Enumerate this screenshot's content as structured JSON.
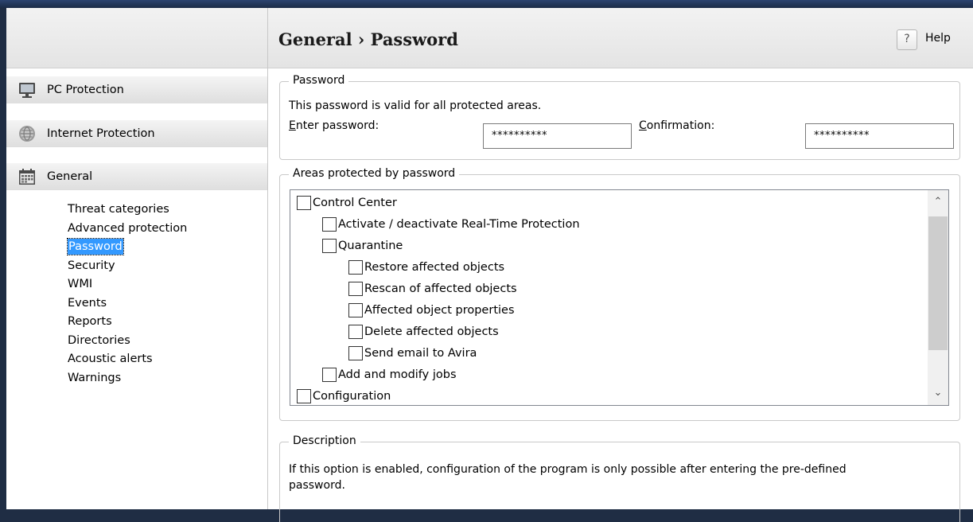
{
  "sidebar": {
    "categories": [
      {
        "label": "PC Protection",
        "icon": "monitor-icon"
      },
      {
        "label": "Internet Protection",
        "icon": "globe-icon"
      },
      {
        "label": "General",
        "icon": "calendar-icon"
      }
    ],
    "general_items": [
      "Threat categories",
      "Advanced protection",
      "Password",
      "Security",
      "WMI",
      "Events",
      "Reports",
      "Directories",
      "Acoustic alerts",
      "Warnings"
    ],
    "selected_item": "Password"
  },
  "header": {
    "title": "General › Password",
    "help_icon_glyph": "?",
    "help_label": "Help"
  },
  "password_group": {
    "legend": "Password",
    "description": "This password is valid for all protected areas.",
    "enter_label_accel": "E",
    "enter_label_rest": "nter password:",
    "enter_value": "**********",
    "confirm_label_accel": "C",
    "confirm_label_rest": "onfirmation:",
    "confirm_value": "**********"
  },
  "areas_group": {
    "legend": "Areas protected by password",
    "tree": [
      {
        "label": "Control Center",
        "checked": false
      },
      {
        "label": "Activate / deactivate Real-Time Protection",
        "checked": false
      },
      {
        "label": "Quarantine",
        "checked": false
      },
      {
        "label": "Restore affected objects",
        "checked": false
      },
      {
        "label": "Rescan of affected objects",
        "checked": false
      },
      {
        "label": "Affected object properties",
        "checked": false
      },
      {
        "label": "Delete affected objects",
        "checked": false
      },
      {
        "label": "Send email to Avira",
        "checked": false
      },
      {
        "label": "Add and modify jobs",
        "checked": false
      },
      {
        "label": "Configuration",
        "checked": false
      }
    ]
  },
  "description_group": {
    "legend": "Description",
    "text_line1": "If this option is enabled, configuration of the program is only possible after entering the pre-defined",
    "text_line2": "password."
  },
  "colors": {
    "selection": "#3399ff",
    "window_frame": "#1f2d44"
  }
}
